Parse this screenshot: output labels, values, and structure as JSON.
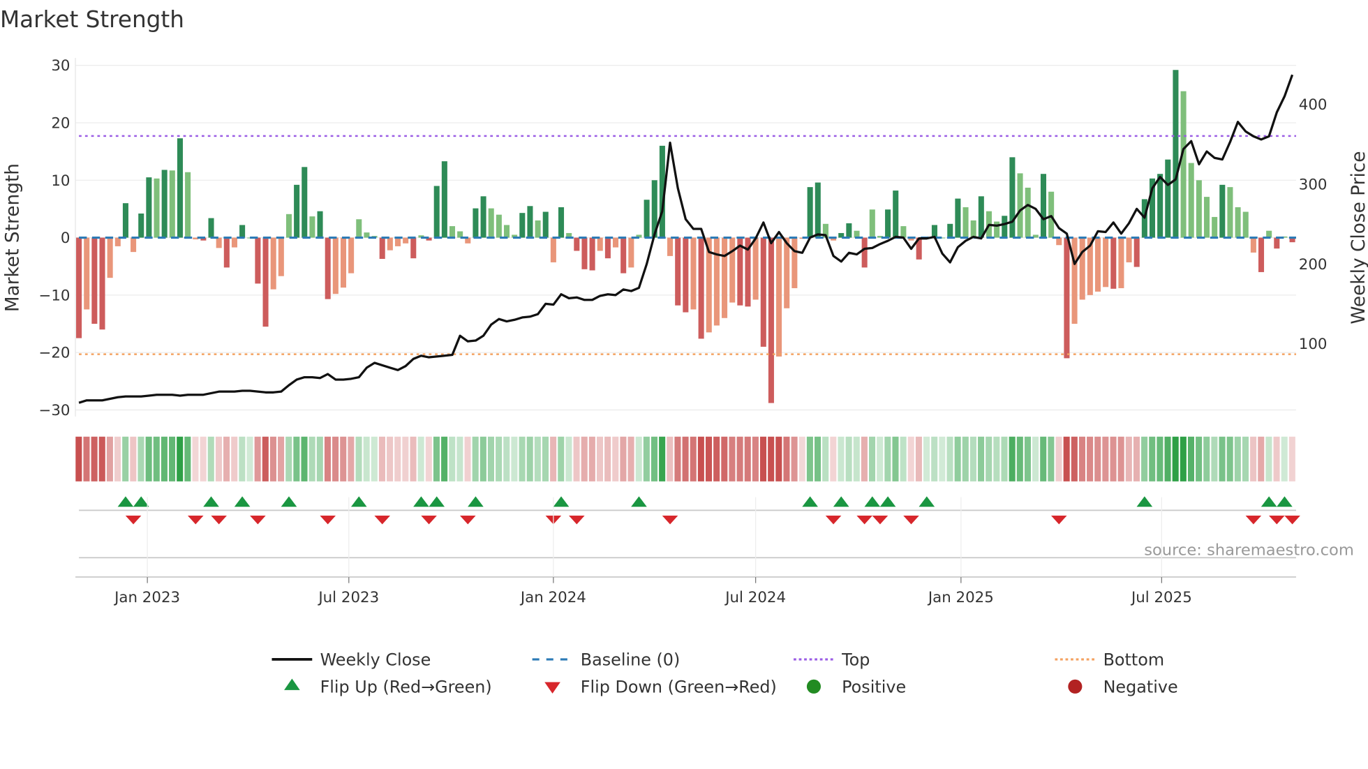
{
  "chart_data": {
    "type": "bar",
    "title": "Market Strength",
    "ylabel": "Market Strength",
    "y2label": "Weekly Close Price",
    "ylim": [
      -30,
      30
    ],
    "yticks": [
      30,
      20,
      10,
      0,
      -10,
      -20,
      -30
    ],
    "yticklabels": [
      "30",
      "20",
      "10",
      "0",
      "−10",
      "−20",
      "−30"
    ],
    "y2ticks": [
      400,
      300,
      200,
      100
    ],
    "y2ticklabels": [
      "400",
      "300",
      "200",
      "100"
    ],
    "xticks": [
      {
        "week": 8.8,
        "label": "Jan 2023"
      },
      {
        "week": 34.7,
        "label": "Jul 2023"
      },
      {
        "week": 61.0,
        "label": "Jan 2024"
      },
      {
        "week": 87.0,
        "label": "Jul 2024"
      },
      {
        "week": 113.4,
        "label": "Jan 2025"
      },
      {
        "week": 139.2,
        "label": "Jul 2025"
      }
    ],
    "top_level": 17.7,
    "bottom_level": -20.3,
    "baseline": 0,
    "strength": [
      -17.5,
      -12.5,
      -15,
      -16,
      -7,
      -1.5,
      6,
      -2.5,
      4.2,
      10.5,
      10.3,
      11.8,
      11.7,
      17.3,
      11.4,
      -0.3,
      -0.5,
      3.4,
      -1.8,
      -5.2,
      -1.7,
      2.2,
      0,
      -8,
      -15.5,
      -9,
      -6.7,
      4.1,
      9.2,
      12.3,
      3.7,
      4.6,
      -10.7,
      -9.8,
      -8.7,
      -6.2,
      3.2,
      0.9,
      0.3,
      -3.7,
      -2.2,
      -1.5,
      -1,
      -3.6,
      0.4,
      -0.5,
      9,
      13.3,
      2,
      1.1,
      -1,
      5.1,
      7.2,
      5.1,
      4,
      2.2,
      0.5,
      4.3,
      5.5,
      3,
      4.5,
      -4.3,
      5.3,
      0.8,
      -2.3,
      -5.5,
      -5.7,
      -2.3,
      -3.6,
      -1.7,
      -6.2,
      -5.2,
      0.5,
      6.6,
      10,
      16,
      -3.2,
      -11.8,
      -13,
      -12.5,
      -17.6,
      -16.5,
      -15.3,
      -14,
      -11.3,
      -11.8,
      -12,
      -10.8,
      -19,
      -28.8,
      -20.7,
      -12.3,
      -8.8,
      -0.2,
      8.8,
      9.6,
      2.4,
      -0.5,
      0.8,
      2.5,
      1.2,
      -5.2,
      4.9,
      0.3,
      4.9,
      8.2,
      2,
      -0.5,
      -3.8,
      0,
      2.2,
      0,
      2.4,
      6.8,
      5.3,
      3,
      7.2,
      4.6,
      2.8,
      3.8,
      14,
      11.2,
      8.7,
      0.5,
      11.1,
      8,
      -1.3,
      -21,
      -15,
      -10.8,
      -10,
      -9.4,
      -8.6,
      -8.9,
      -8.8,
      -4.3,
      -5.1,
      6.7,
      10.3,
      11.1,
      13.6,
      29.2,
      25.5,
      13,
      10,
      7.1,
      3.6,
      9.2,
      8.8,
      5.3,
      4.5,
      -2.6,
      -6,
      1.2,
      -1.9,
      0.2,
      -0.8
    ],
    "weekly_close": [
      26,
      29,
      29,
      29,
      31,
      33,
      34,
      34,
      34,
      35,
      36,
      36,
      36,
      35,
      36,
      36,
      36,
      38,
      40,
      40,
      40,
      41,
      41,
      40,
      39,
      39,
      40,
      48,
      55,
      58,
      58,
      57,
      62,
      55,
      55,
      56,
      58,
      70,
      76,
      73,
      70,
      67,
      72,
      81,
      85,
      83,
      84,
      85,
      86,
      110,
      103,
      104,
      110,
      124,
      131,
      128,
      130,
      133,
      134,
      137,
      150,
      149,
      162,
      157,
      158,
      155,
      155,
      160,
      162,
      161,
      168,
      166,
      170,
      200,
      237,
      266,
      352,
      295,
      256,
      244,
      244,
      215,
      212,
      210,
      216,
      223,
      218,
      232,
      252,
      226,
      240,
      226,
      216,
      214,
      233,
      237,
      236,
      210,
      203,
      214,
      212,
      219,
      220,
      225,
      229,
      234,
      233,
      219,
      232,
      232,
      234,
      213,
      202,
      221,
      229,
      234,
      232,
      249,
      248,
      250,
      253,
      267,
      274,
      269,
      256,
      260,
      245,
      238,
      200,
      215,
      223,
      241,
      240,
      252,
      238,
      251,
      269,
      258,
      295,
      309,
      299,
      306,
      344,
      354,
      325,
      341,
      333,
      331,
      353,
      378,
      366,
      360,
      356,
      360,
      390,
      410,
      437
    ],
    "flip_up_weeks": [
      6,
      8,
      17,
      21,
      27,
      36,
      44,
      46,
      51,
      62,
      72,
      94,
      98,
      102,
      104,
      109,
      137,
      153,
      155
    ],
    "flip_down_weeks": [
      7,
      15,
      18,
      23,
      32,
      39,
      45,
      50,
      61,
      64,
      76,
      97,
      101,
      103,
      107,
      126,
      151,
      154,
      156
    ],
    "legend": [
      {
        "label": "Weekly Close",
        "symbol": "line-solid",
        "color": "#111111"
      },
      {
        "label": "Baseline (0)",
        "symbol": "line-dash",
        "color": "#2c7bb6"
      },
      {
        "label": "Top",
        "symbol": "line-dot",
        "color": "#9b5de5"
      },
      {
        "label": "Bottom",
        "symbol": "line-dot",
        "color": "#f4a261"
      },
      {
        "label": "Flip Up (Red→Green)",
        "symbol": "triangle-up",
        "color": "#1a9641"
      },
      {
        "label": "Flip Down (Green→Red)",
        "symbol": "triangle-down",
        "color": "#d7262b"
      },
      {
        "label": "Positive",
        "symbol": "circle",
        "color": "#228b22"
      },
      {
        "label": "Negative",
        "symbol": "circle",
        "color": "#b22222"
      }
    ],
    "legend_placement": "bottom",
    "source": "source: sharemaestro.com",
    "colors": {
      "pos_strong": "#2e8b57",
      "pos_weak": "#7fbf7b",
      "neg_strong": "#cd5c5c",
      "neg_weak": "#e9967a"
    }
  }
}
